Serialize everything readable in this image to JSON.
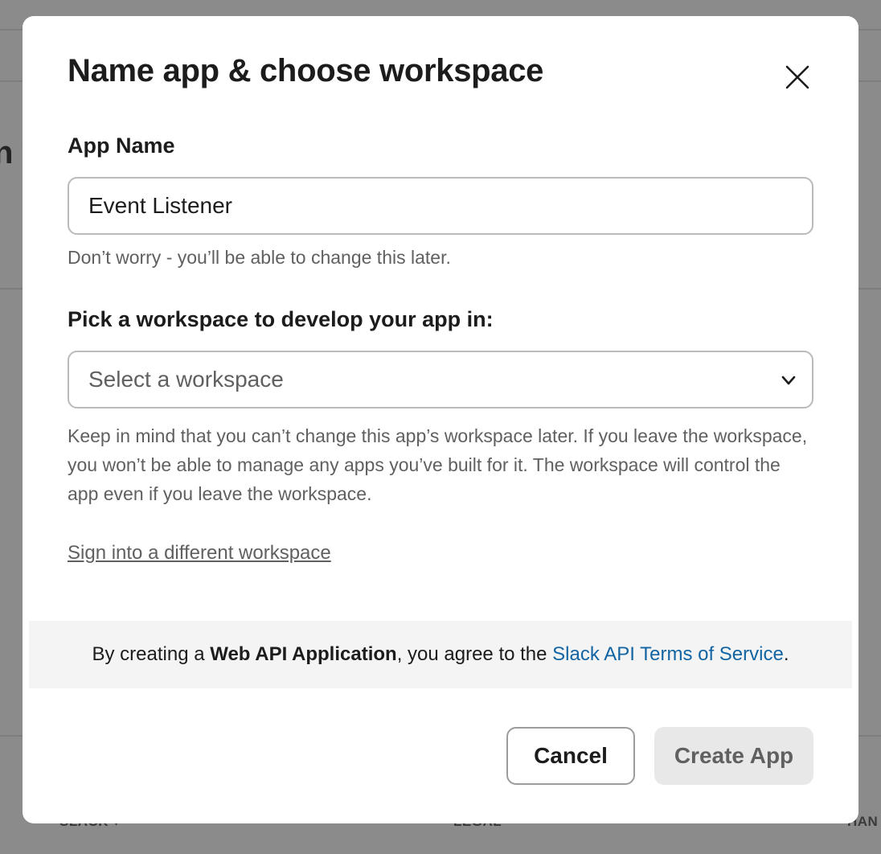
{
  "background": {
    "heading_fragment": "n T",
    "footer": {
      "col1": "SLACK",
      "col2": "LEGAL",
      "col3": "HAN"
    }
  },
  "modal": {
    "title": "Name app & choose workspace",
    "close_icon": "close-icon",
    "app_name": {
      "label": "App Name",
      "value": "Event Listener",
      "hint": "Don’t worry - you’ll be able to change this later."
    },
    "workspace": {
      "label": "Pick a workspace to develop your app in:",
      "selected": "Select a workspace",
      "chevron_icon": "chevron-down-icon",
      "note": "Keep in mind that you can’t change this app’s workspace later. If you leave the workspace, you won’t be able to manage any apps you’ve built for it. The workspace will control the app even if you leave the workspace."
    },
    "sign_in_link": "Sign into a different workspace",
    "terms": {
      "prefix": "By creating a ",
      "app_type": "Web API Application",
      "middle": ", you agree to the ",
      "link": "Slack API Terms of Service",
      "suffix": "."
    },
    "buttons": {
      "cancel": "Cancel",
      "create": "Create App"
    }
  },
  "colors": {
    "link": "#1264a3",
    "text": "#1d1c1d",
    "muted": "#616061",
    "overlay": "#8b8b8b"
  }
}
